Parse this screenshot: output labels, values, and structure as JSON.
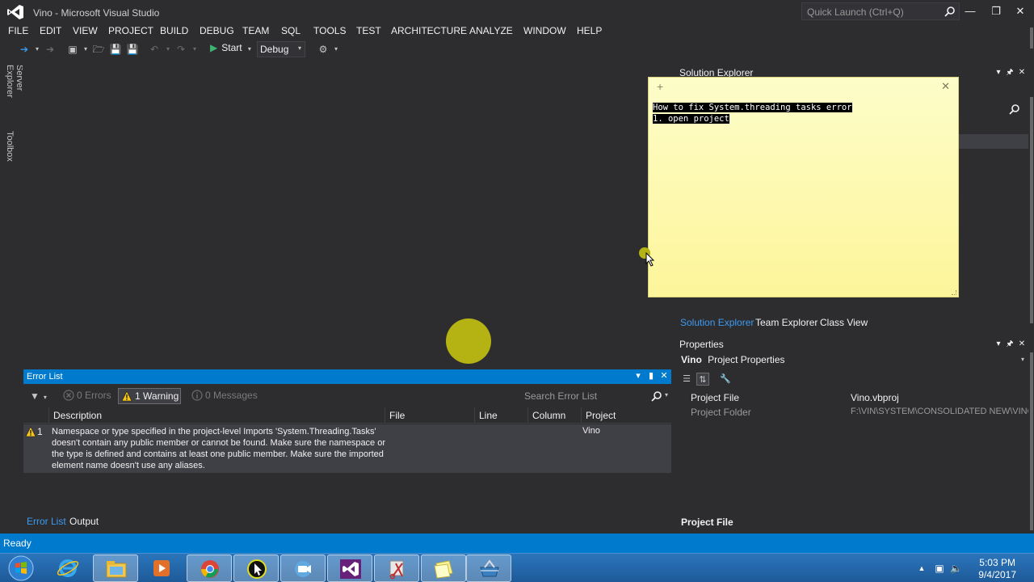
{
  "window": {
    "title": "Vino - Microsoft Visual Studio",
    "quick_launch_placeholder": "Quick Launch (Ctrl+Q)"
  },
  "menu": [
    "FILE",
    "EDIT",
    "VIEW",
    "PROJECT",
    "BUILD",
    "DEBUG",
    "TEAM",
    "SQL",
    "TOOLS",
    "TEST",
    "ARCHITECTURE",
    "ANALYZE",
    "WINDOW",
    "HELP"
  ],
  "toolbar": {
    "start_label": "Start",
    "configuration": "Debug"
  },
  "side_tabs": [
    "Server Explorer",
    "Toolbox"
  ],
  "sticky_note": {
    "lines": [
      "How to fix System.threading tasks error",
      "1. open project"
    ]
  },
  "error_list": {
    "title": "Error List",
    "errors_label": "0 Errors",
    "warnings_label": "1 Warning",
    "messages_label": "0 Messages",
    "search_placeholder": "Search Error List",
    "columns": [
      "Description",
      "File",
      "Line",
      "Column",
      "Project"
    ],
    "rows": [
      {
        "number": "1",
        "description": "Namespace or type specified in the project-level Imports 'System.Threading.Tasks' doesn't contain any public member or cannot be found. Make sure the namespace or the type is defined and contains at least one public member. Make sure the imported element name doesn't use any aliases.",
        "file": "",
        "line": "",
        "column": "",
        "project": "Vino"
      }
    ],
    "bottom_tabs": [
      "Error List",
      "Output"
    ]
  },
  "solution_explorer": {
    "title": "Solution Explorer",
    "tabs": [
      "Solution Explorer",
      "Team Explorer",
      "Class View"
    ]
  },
  "properties": {
    "title": "Properties",
    "object_name": "Vino",
    "object_type": "Project Properties",
    "rows": [
      {
        "name": "Project File",
        "value": "Vino.vbproj"
      },
      {
        "name": "Project Folder",
        "value": "F:\\VIN\\SYSTEM\\CONSOLIDATED NEW\\VINO"
      }
    ],
    "description_title": "Project File"
  },
  "status": {
    "text": "Ready"
  },
  "taskbar": {
    "time": "5:03 PM",
    "date": "9/4/2017"
  },
  "colors": {
    "accent": "#007acc",
    "background": "#2d2d30",
    "sticky_note": "#fdf59a",
    "warning": "#f5c518"
  }
}
